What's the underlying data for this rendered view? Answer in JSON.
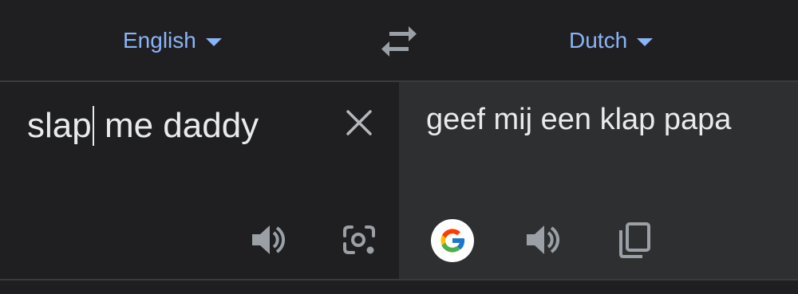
{
  "languages": {
    "source": "English",
    "target": "Dutch"
  },
  "input": {
    "text_before_cursor": "slap",
    "text_after_cursor": " me daddy"
  },
  "output": {
    "translation": "geef mij een klap papa"
  },
  "icons": {
    "swap": "swap-arrows-icon",
    "clear": "close-icon",
    "speak_source": "volume-icon",
    "camera": "camera-lens-icon",
    "google": "google-logo-icon",
    "speak_target": "volume-icon",
    "copy": "copy-icon"
  },
  "colors": {
    "accent": "#8ab4f8",
    "background": "#1f1f21",
    "target_panel": "#2e2f31",
    "text": "#e8eaed",
    "icon": "#9aa0a6"
  }
}
